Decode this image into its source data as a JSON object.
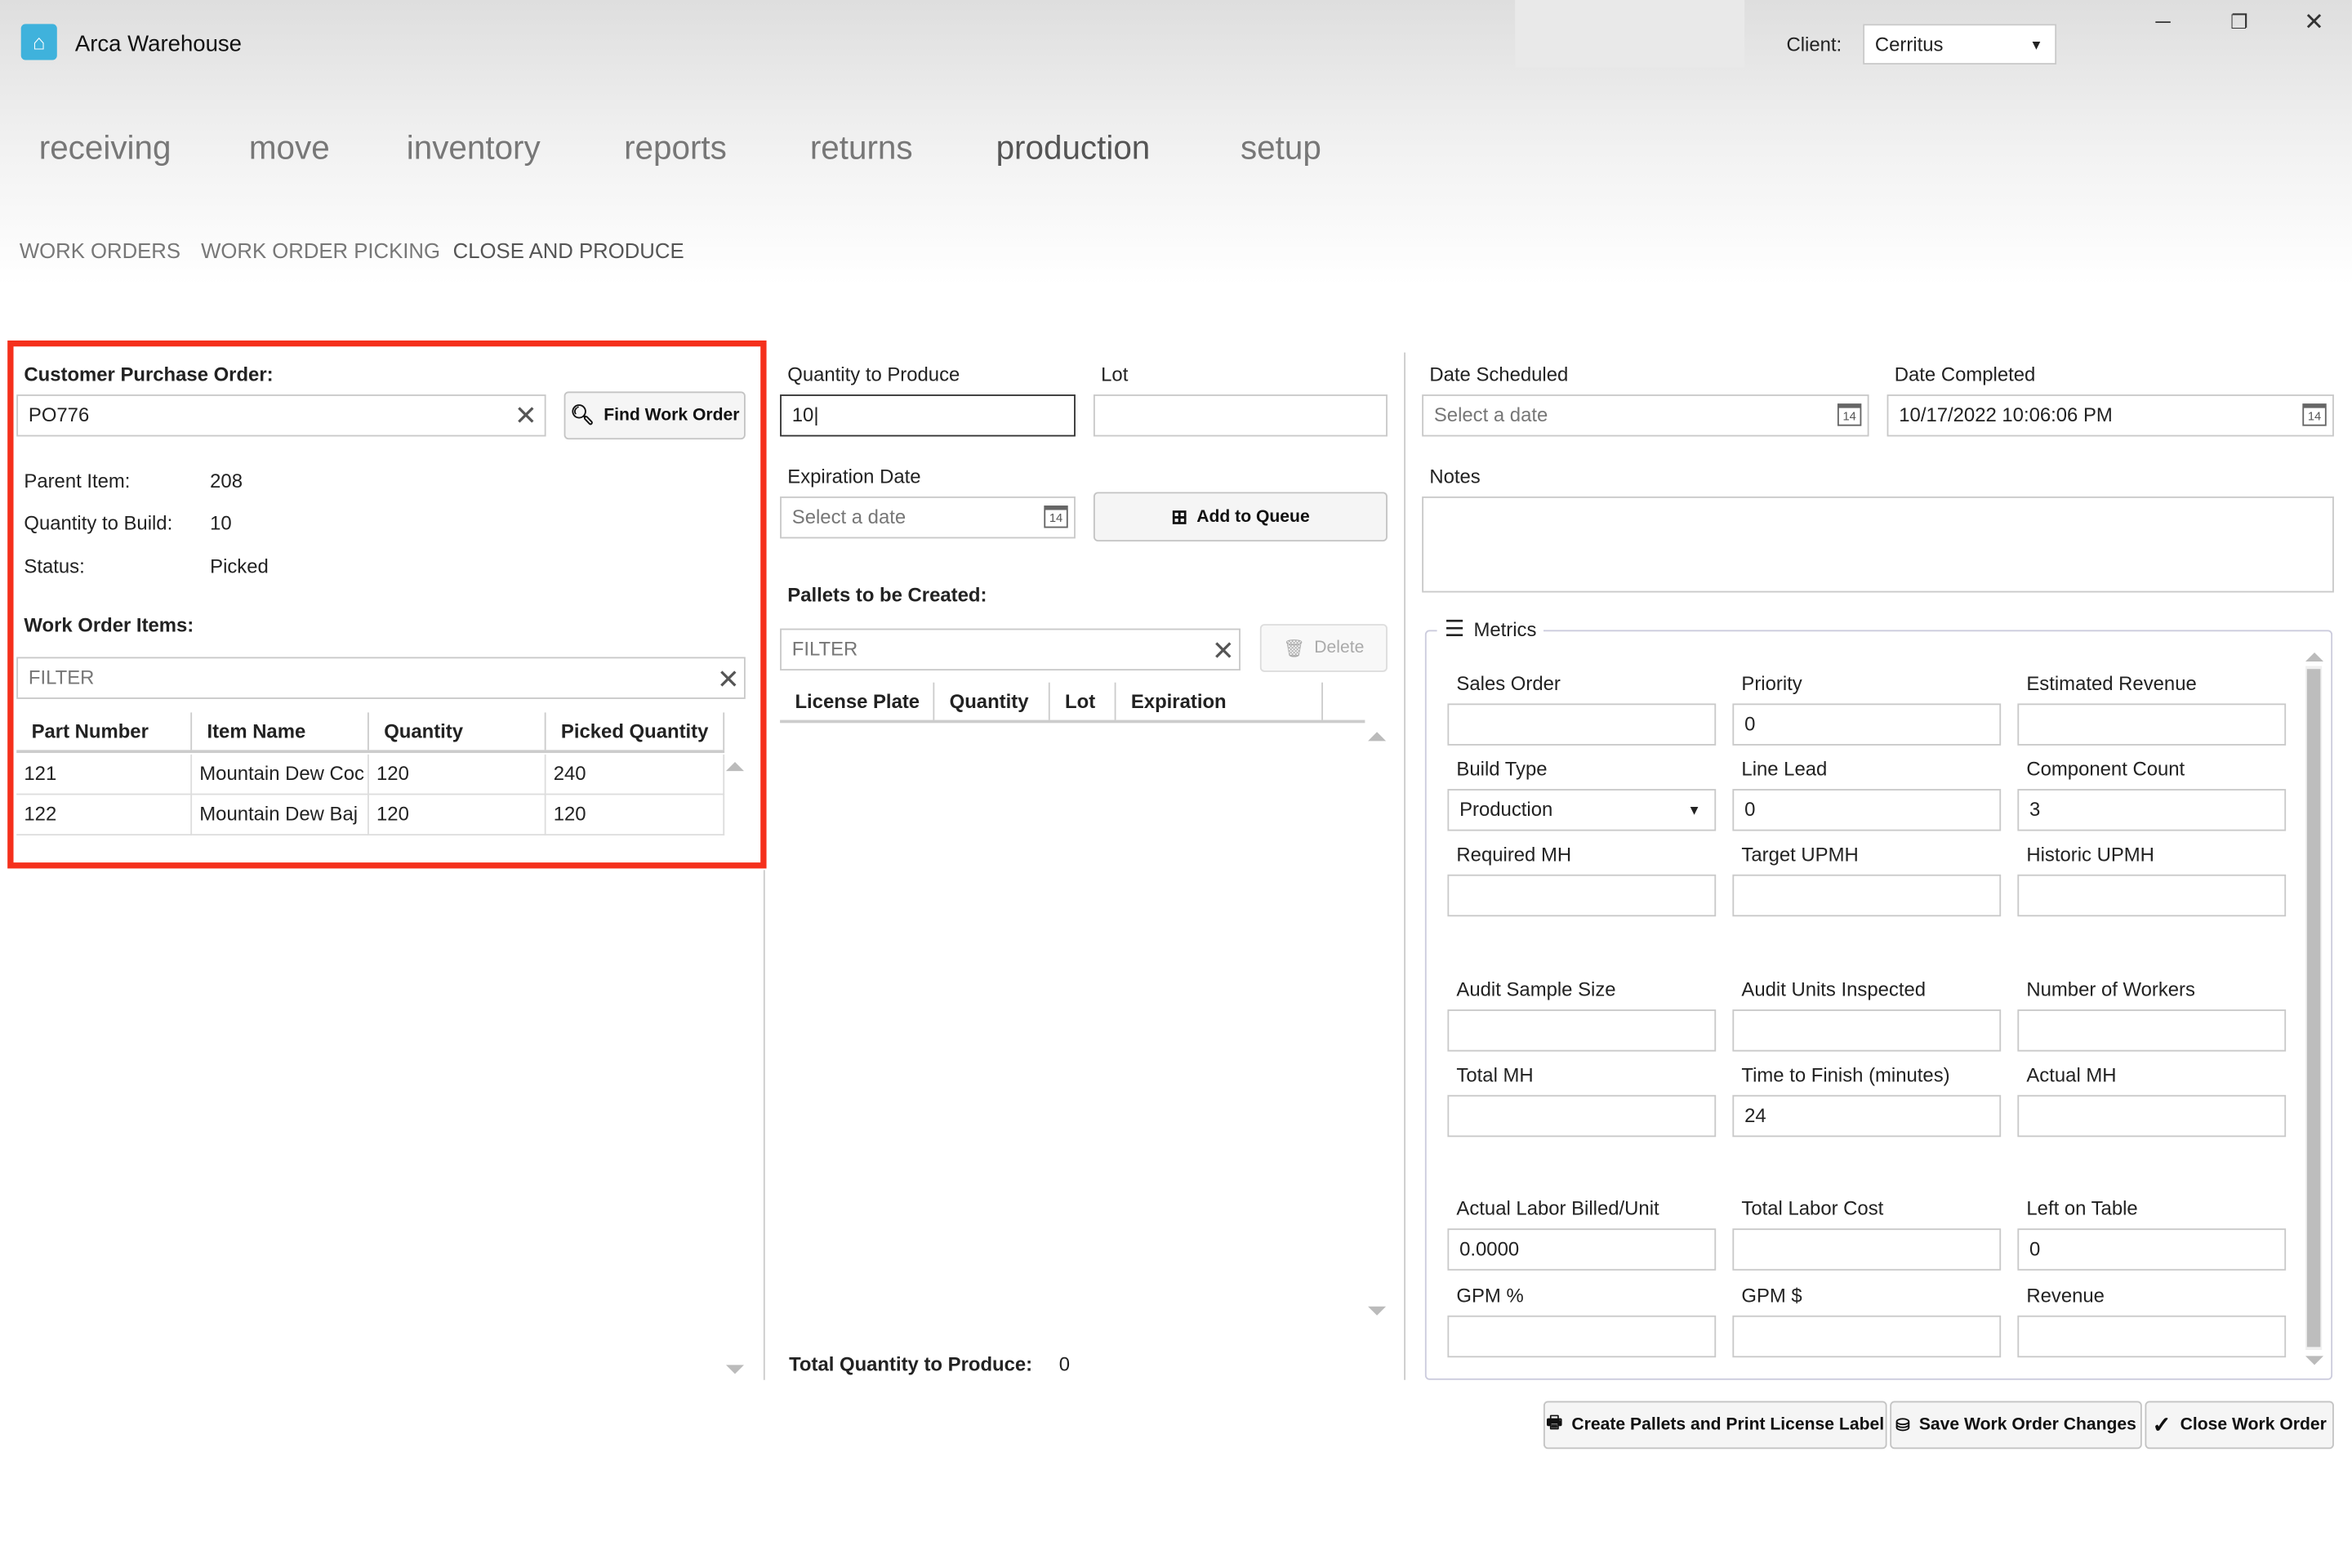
{
  "app": {
    "title": "Arca Warehouse",
    "client_label": "Client:",
    "client_value": "Cerritus"
  },
  "nav": [
    "receiving",
    "move",
    "inventory",
    "reports",
    "returns",
    "production",
    "setup"
  ],
  "subnav": [
    "WORK ORDERS",
    "WORK ORDER PICKING",
    "CLOSE AND PRODUCE"
  ],
  "left": {
    "cpo_label": "Customer Purchase Order:",
    "cpo_value": "PO776",
    "find_button": "Find Work Order",
    "parent_item_label": "Parent Item:",
    "parent_item": "208",
    "qty_build_label": "Quantity to Build:",
    "qty_build": "10",
    "status_label": "Status:",
    "status": "Picked",
    "items_label": "Work Order Items:",
    "filter_placeholder": "FILTER",
    "columns": [
      "Part Number",
      "Item Name",
      "Quantity",
      "Picked Quantity"
    ],
    "rows": [
      [
        "121",
        "Mountain Dew Coc",
        "120",
        "240"
      ],
      [
        "122",
        "Mountain Dew Baj",
        "120",
        "120"
      ]
    ]
  },
  "middle": {
    "qty_label": "Quantity to Produce",
    "qty_value": "10",
    "lot_label": "Lot",
    "lot_value": "",
    "exp_label": "Expiration Date",
    "exp_placeholder": "Select a date",
    "add_queue": "Add to Queue",
    "pallets_label": "Pallets to be Created:",
    "filter_placeholder": "FILTER",
    "delete": "Delete",
    "columns": [
      "License Plate",
      "Quantity",
      "Lot",
      "Expiration"
    ],
    "total_label": "Total Quantity to Produce:",
    "total_value": "0"
  },
  "right": {
    "sched_label": "Date Scheduled",
    "sched_placeholder": "Select a date",
    "completed_label": "Date Completed",
    "completed_value": "10/17/2022 10:06:06 PM",
    "notes_label": "Notes",
    "metrics_title": "Metrics",
    "metrics": [
      {
        "label": "Sales Order",
        "value": ""
      },
      {
        "label": "Priority",
        "value": "0"
      },
      {
        "label": "Estimated Revenue",
        "value": ""
      },
      {
        "label": "Build Type",
        "value": "Production",
        "select": true
      },
      {
        "label": "Line Lead",
        "value": "0"
      },
      {
        "label": "Component Count",
        "value": "3"
      },
      {
        "label": "Required MH",
        "value": ""
      },
      {
        "label": "Target UPMH",
        "value": ""
      },
      {
        "label": "Historic UPMH",
        "value": ""
      },
      {
        "label": "Audit Sample Size",
        "value": ""
      },
      {
        "label": "Audit Units Inspected",
        "value": ""
      },
      {
        "label": "Number of Workers",
        "value": ""
      },
      {
        "label": "Total MH",
        "value": ""
      },
      {
        "label": "Time to Finish (minutes)",
        "value": "24"
      },
      {
        "label": "Actual MH",
        "value": ""
      },
      {
        "label": "Actual Labor Billed/Unit",
        "value": "0.0000"
      },
      {
        "label": "Total Labor Cost",
        "value": ""
      },
      {
        "label": "Left on Table",
        "value": "0"
      },
      {
        "label": "GPM %",
        "value": ""
      },
      {
        "label": "GPM $",
        "value": ""
      },
      {
        "label": "Revenue",
        "value": ""
      }
    ]
  },
  "actions": {
    "create_pallets": "Create Pallets and Print License Label",
    "save": "Save Work Order Changes",
    "close": "Close Work Order"
  },
  "colors": {
    "highlight": "#f5301c",
    "logo": "#3fb2dc"
  }
}
